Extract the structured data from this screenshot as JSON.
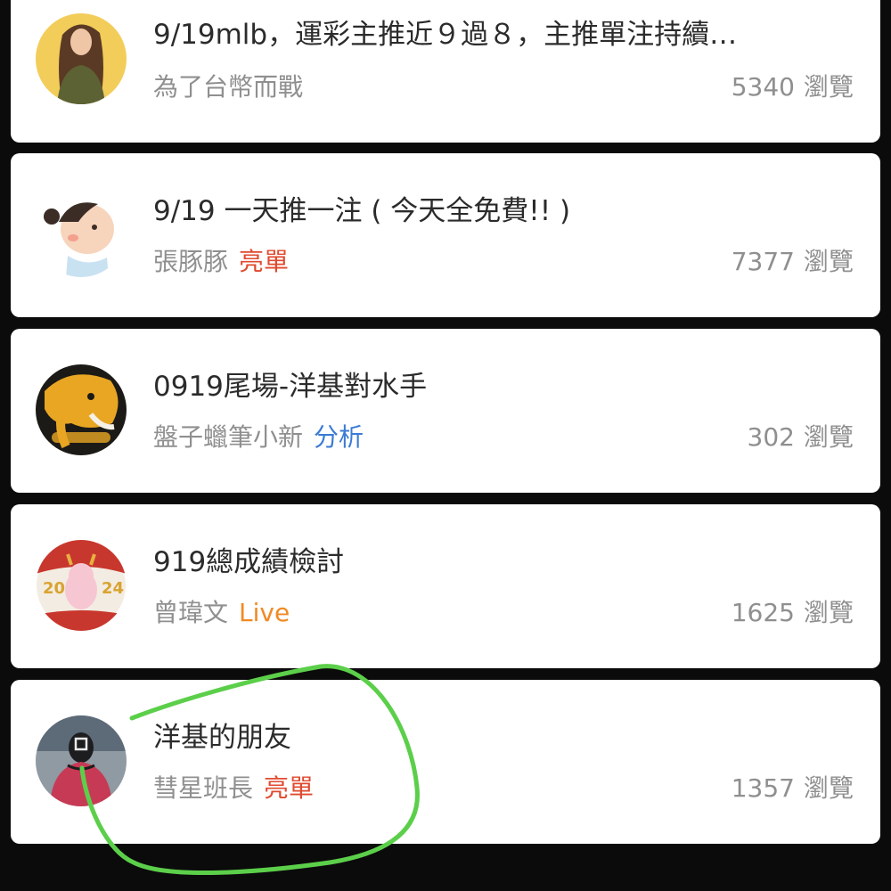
{
  "posts": [
    {
      "title": "9/19mlb，運彩主推近９過８，主推單注持續…",
      "author": "為了台幣而戰",
      "tag": "",
      "views": "5340",
      "views_unit": "瀏覽"
    },
    {
      "title": "9/19 一天推一注 ( 今天全免費!! )",
      "author": "張豚豚",
      "tag": "亮單",
      "tag_color": "#e04a2f",
      "views": "7377",
      "views_unit": "瀏覽"
    },
    {
      "title": "0919尾場-洋基對水手",
      "author": "盤子蠟筆小新",
      "tag": "分析",
      "tag_color": "#3a7bd5",
      "views": "302",
      "views_unit": "瀏覽"
    },
    {
      "title": "919總成績檢討",
      "author": "曾瑋文",
      "tag": "Live",
      "tag_color": "#f08a24",
      "avatar_text_left": "20",
      "avatar_text_right": "24",
      "views": "1625",
      "views_unit": "瀏覽"
    },
    {
      "title": "洋基的朋友",
      "author": "彗星班長",
      "tag": "亮單",
      "tag_color": "#e04a2f",
      "views": "1357",
      "views_unit": "瀏覽"
    }
  ],
  "colors": {
    "background": "#0b0b0b",
    "card": "#ffffff",
    "title_text": "#2b2b2b",
    "meta_text": "#8f8f8f",
    "annotation_stroke": "#5ccf4a"
  }
}
